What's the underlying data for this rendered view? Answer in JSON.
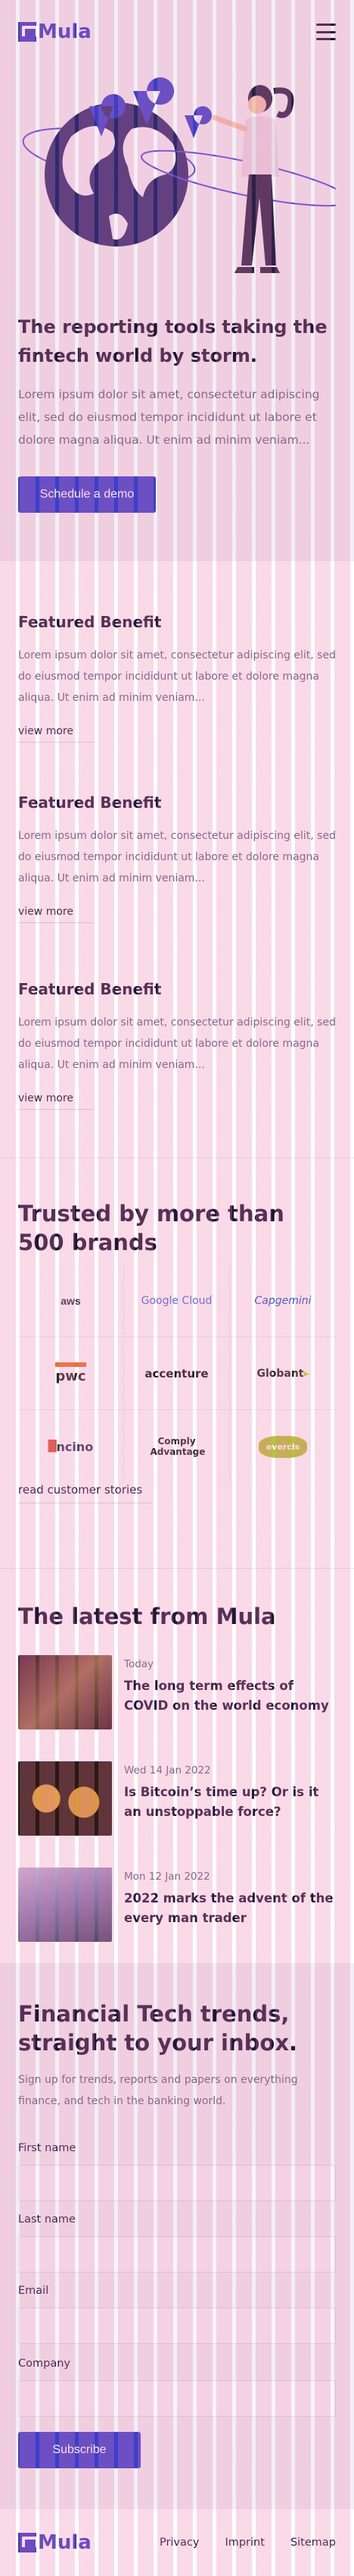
{
  "brand": {
    "name": "Mula",
    "color": "#3a3ac8"
  },
  "header": {
    "menu_icon": "hamburger-icon"
  },
  "hero": {
    "title": "The reporting tools taking the fintech world by storm.",
    "text": "Lorem ipsum dolor sit amet, consectetur adipiscing elit, sed do eiusmod tempor incididunt ut labore et dolore magna aliqua. Ut enim ad minim veniam...",
    "button": "Schedule a demo"
  },
  "benefits": [
    {
      "title": "Featured Benefit",
      "text": "Lorem ipsum dolor sit amet, consectetur adipiscing elit, sed do eiusmod tempor incididunt ut labore et dolore magna aliqua. Ut enim ad minim veniam...",
      "link": "view more"
    },
    {
      "title": "Featured Benefit",
      "text": "Lorem ipsum dolor sit amet, consectetur adipiscing elit, sed do eiusmod tempor incididunt ut labore et dolore magna aliqua. Ut enim ad minim veniam...",
      "link": "view more"
    },
    {
      "title": "Featured Benefit",
      "text": "Lorem ipsum dolor sit amet, consectetur adipiscing elit, sed do eiusmod tempor incididunt ut labore et dolore magna aliqua. Ut enim ad minim veniam...",
      "link": "view more"
    }
  ],
  "trusted": {
    "title": "Trusted by more than 500 brands",
    "logos": [
      "aws",
      "Google Cloud",
      "Capgemini",
      "pwc",
      "accenture",
      "Globant",
      "ncino",
      "Comply Advantage",
      "evercis"
    ],
    "link": "read customer stories"
  },
  "latest": {
    "title": "The latest from Mula",
    "posts": [
      {
        "date": "Today",
        "title": "The long term effects of COVID on the world economy"
      },
      {
        "date": "Wed 14 Jan 2022",
        "title": "Is Bitcoin’s time up? Or is it an unstoppable force?"
      },
      {
        "date": "Mon 12 Jan 2022",
        "title": "2022 marks the advent of the every man trader"
      }
    ]
  },
  "newsletter": {
    "title": "Financial Tech trends, straight to your inbox.",
    "text": "Sign up for trends, reports and papers on everything finance, and tech in the banking world.",
    "fields": [
      "First name",
      "Last name",
      "Email",
      "Company"
    ],
    "button": "Subscribe"
  },
  "footer": {
    "links": [
      "Privacy",
      "Imprint",
      "Sitemap"
    ]
  }
}
